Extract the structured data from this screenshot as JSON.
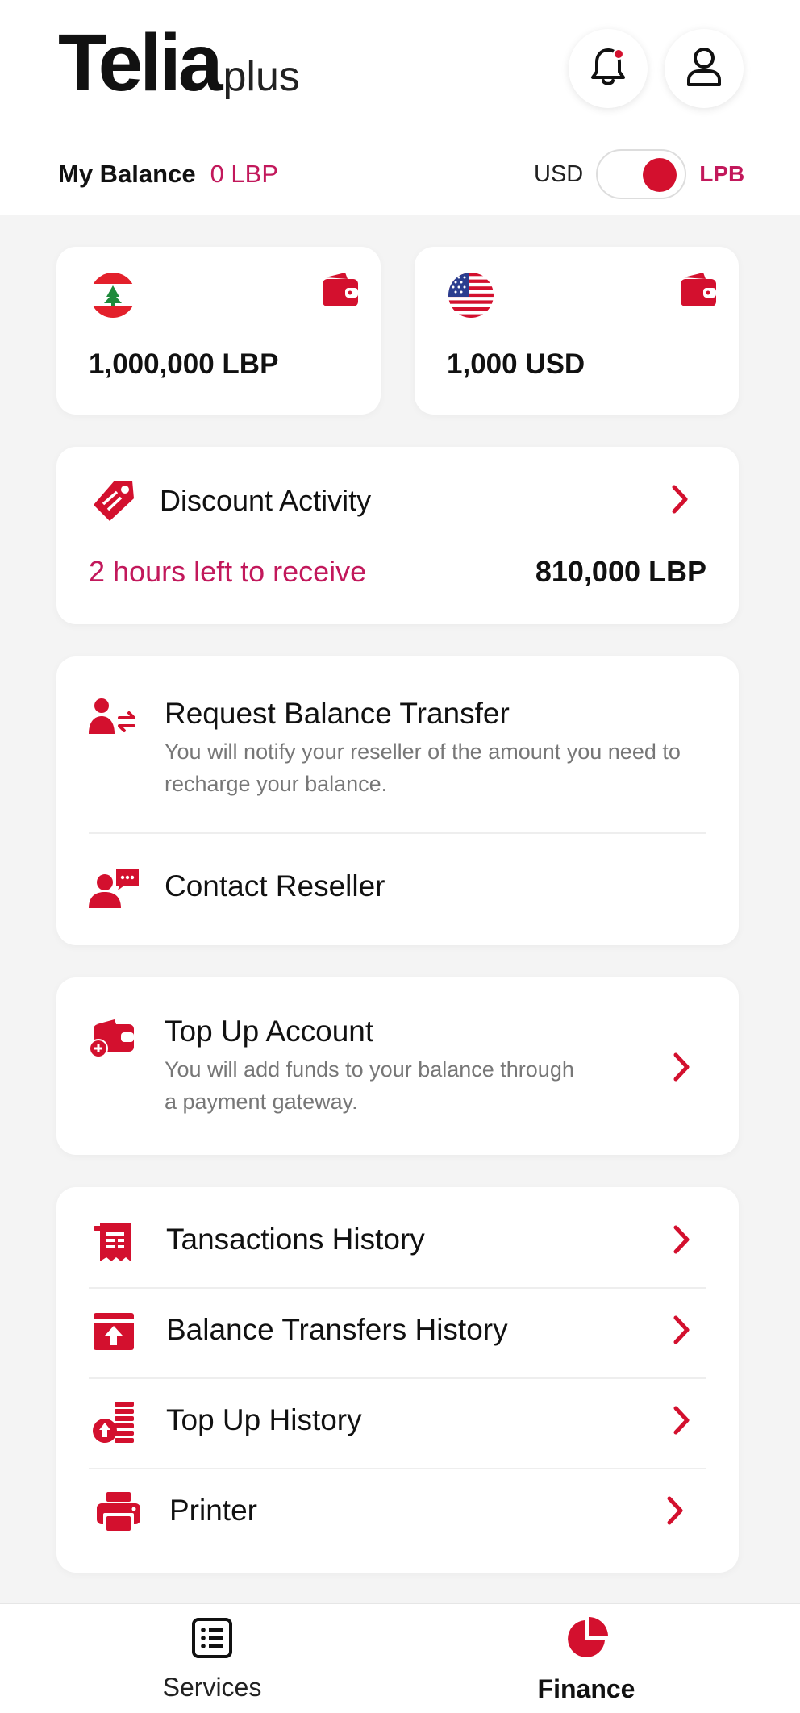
{
  "header": {
    "logo_main": "Telia",
    "logo_sub": "plus",
    "balance_label": "My Balance",
    "balance_value": "0 LBP",
    "currency_left": "USD",
    "currency_right": "LPB"
  },
  "wallets": [
    {
      "flag": "lebanon-flag",
      "amount": "1,000,000 LBP"
    },
    {
      "flag": "usa-flag",
      "amount": "1,000 USD"
    }
  ],
  "discount": {
    "title": "Discount Activity",
    "time_left": "2 hours left to receive",
    "amount": "810,000 LBP"
  },
  "transfer": {
    "request_title": "Request Balance Transfer",
    "request_desc": "You will notify your reseller of the amount you need to recharge your balance.",
    "contact_title": "Contact Reseller"
  },
  "topup": {
    "title": "Top Up Account",
    "desc": "You will add funds to your balance through a payment gateway."
  },
  "history": {
    "items": [
      {
        "label": "Tansactions History",
        "icon": "receipt-icon"
      },
      {
        "label": "Balance Transfers History",
        "icon": "upload-box-icon"
      },
      {
        "label": "Top Up History",
        "icon": "coin-stack-icon"
      },
      {
        "label": "Printer",
        "icon": "printer-icon"
      }
    ]
  },
  "nav": {
    "services": "Services",
    "finance": "Finance"
  },
  "colors": {
    "accent": "#d3102e",
    "accent_text": "#c2185b",
    "background": "#f4f4f4"
  }
}
